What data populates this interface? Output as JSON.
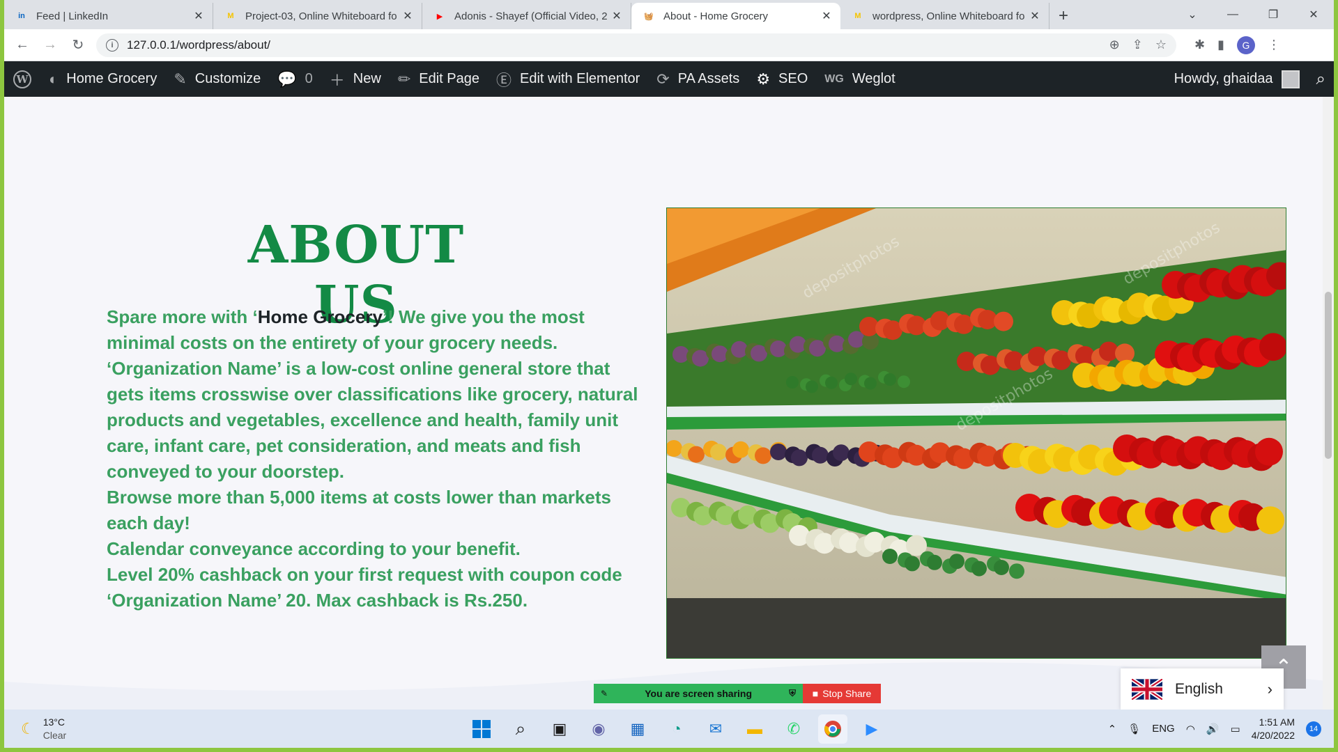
{
  "browser": {
    "tabs": [
      {
        "title": "Feed | LinkedIn",
        "favicon": "linkedin-icon",
        "color": "#0a66c2",
        "glyph": "in"
      },
      {
        "title": "Project-03, Online Whiteboard fo",
        "favicon": "miro-icon",
        "color": "#f5c400",
        "glyph": "M"
      },
      {
        "title": "Adonis - Shayef (Official Video, 2",
        "favicon": "youtube-icon",
        "color": "#ff0000",
        "glyph": "▶"
      },
      {
        "title": "About - Home Grocery",
        "favicon": "grocery-basket-icon",
        "color": "#8b5a2b",
        "glyph": "🧺"
      },
      {
        "title": "wordpress, Online Whiteboard fo",
        "favicon": "miro-icon",
        "color": "#f5c400",
        "glyph": "M"
      }
    ],
    "active_tab": 3,
    "url": "127.0.0.1/wordpress/about/",
    "profile_initial": "G"
  },
  "adminbar": {
    "site_name": "Home Grocery",
    "customize": "Customize",
    "comments_count": "0",
    "new": "New",
    "edit_page": "Edit Page",
    "edit_elementor": "Edit with Elementor",
    "pa_assets": "PA Assets",
    "seo": "SEO",
    "weglot": "Weglot",
    "howdy": "Howdy, ghaidaa"
  },
  "content": {
    "heading": "ABOUT US",
    "p1_pre": "Spare more with ‘",
    "p1_brand": "Home Grocery",
    "p1_post": "’! We give you the most minimal costs on the entirety of your grocery needs.",
    "p2": "‘Organization Name’ is a low-cost online general store that gets items crosswise over classifications like grocery, natural products and vegetables, excellence and health, family unit care, infant care, pet consideration, and meats and fish conveyed to your doorstep.",
    "p3": "Browse more than 5,000 items at costs lower than markets each day!",
    "p4": "Calendar conveyance according to your benefit.",
    "p5": "Level 20% cashback on your first request with coupon code ‘Organization Name’ 20. Max cashback is Rs.250.",
    "image_watermark": "depositphotos",
    "colors": {
      "heading": "#138a45",
      "text": "#3aa060"
    }
  },
  "widgets": {
    "language": "English",
    "share_message": "You are screen sharing",
    "stop_share": "Stop Share"
  },
  "taskbar": {
    "temperature": "13°C",
    "weather": "Clear",
    "language": "ENG",
    "time": "1:51 AM",
    "date": "4/20/2022",
    "notifications": "14"
  }
}
